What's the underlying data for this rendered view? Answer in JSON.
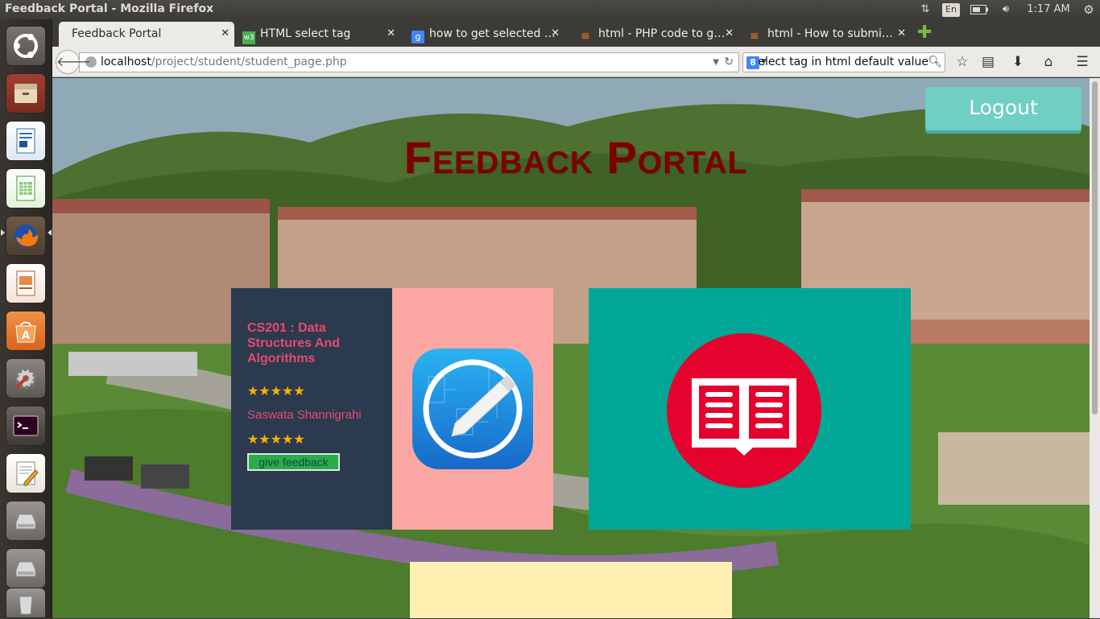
{
  "window": {
    "title": "Feedback Portal - Mozilla Firefox"
  },
  "tray": {
    "language": "En",
    "clock": "1:17 AM"
  },
  "launcher": {
    "items": [
      "ubuntu-dash-icon",
      "files-icon",
      "writer-icon",
      "calc-icon",
      "firefox-icon",
      "impress-icon",
      "software-center-icon",
      "system-settings-icon",
      "terminal-icon",
      "text-editor-icon",
      "drive-icon",
      "drive-icon",
      "trash-icon"
    ]
  },
  "tabs": [
    {
      "title": "Feedback Portal",
      "active": true
    },
    {
      "title": "HTML select tag",
      "active": false
    },
    {
      "title": "how to get selected …",
      "active": false
    },
    {
      "title": "html - PHP code to g…",
      "active": false
    },
    {
      "title": "html - How to submi…",
      "active": false
    }
  ],
  "url": {
    "host": "localhost",
    "path": "/project/student/student_page.php"
  },
  "search": {
    "engine": "8",
    "text": "elect tag in html default value"
  },
  "page": {
    "logout": "Logout",
    "title": "Feedback Portal",
    "course": {
      "name": "CS201 : Data Structures And Algorithms",
      "course_stars": "★★★★★",
      "teacher": "Saswata Shannigrahi",
      "teacher_stars": "★★★★★",
      "feedback_button": "give feedback"
    }
  },
  "colors": {
    "title": "#7d0000",
    "course_card": "#2b3a4f",
    "course_text": "#e74a6e",
    "pink_tile": "#fba7a3",
    "teal_tile": "#00a796",
    "yellow_tile": "#ffefb0",
    "logout": "#6fcfc3",
    "feedback_button": "#27ae49"
  }
}
